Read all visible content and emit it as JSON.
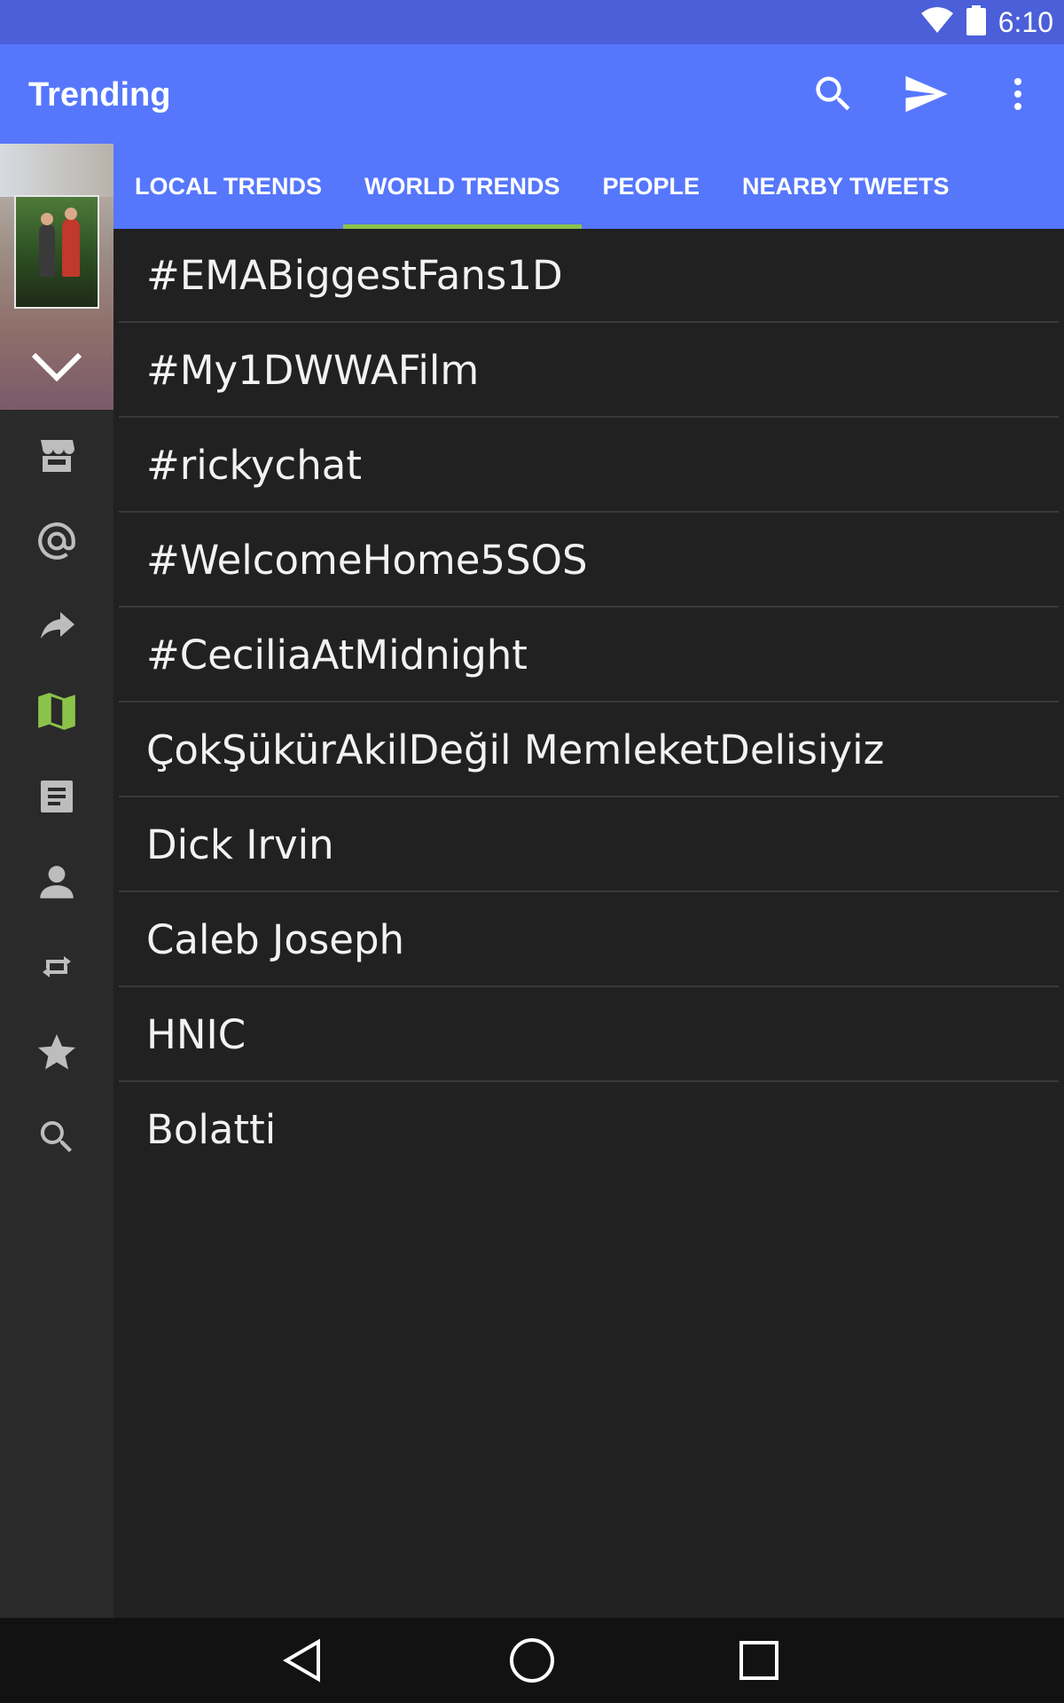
{
  "status_bar": {
    "time": "6:10"
  },
  "app_bar": {
    "title": "Trending",
    "actions": [
      {
        "name": "search-icon"
      },
      {
        "name": "send-icon"
      },
      {
        "name": "more-vert-icon"
      }
    ]
  },
  "tabs": [
    {
      "label": "LOCAL TRENDS",
      "active": false
    },
    {
      "label": "WORLD TRENDS",
      "active": true
    },
    {
      "label": "PEOPLE",
      "active": false
    },
    {
      "label": "NEARBY TWEETS",
      "active": false
    }
  ],
  "side_nav": {
    "icons": [
      "store-icon",
      "at-icon",
      "share-icon",
      "map-icon",
      "article-icon",
      "person-icon",
      "retweet-icon",
      "star-icon",
      "search-icon"
    ],
    "active_icon": "map-icon",
    "active_color": "#8bc34a",
    "icon_color": "#bdbdbd"
  },
  "trends": [
    "#EMABiggestFans1D",
    "#My1DWWAFilm",
    "#rickychat",
    "#WelcomeHome5SOS",
    "#CeciliaAtMidnight",
    "ÇokŞükürAkilDeğil MemleketDelisiyiz",
    "Dick Irvin",
    "Caleb Joseph",
    "HNIC",
    "Bolatti"
  ],
  "colors": {
    "primary": "#5677fc",
    "primary_dark": "#4a5fd8",
    "accent": "#8bc34a",
    "background": "#212121"
  }
}
